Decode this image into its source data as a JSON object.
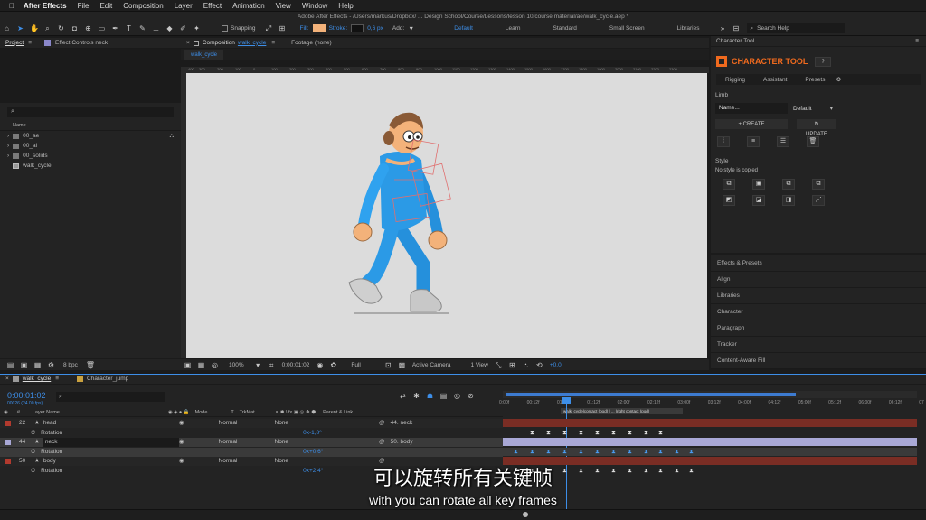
{
  "menubar": {
    "app": "After Effects",
    "items": [
      "File",
      "Edit",
      "Composition",
      "Layer",
      "Effect",
      "Animation",
      "View",
      "Window",
      "Help"
    ]
  },
  "title": "Adobe After Effects - /Users/markus/Dropbox/ ... Design School/Course/Lessons/lesson 10/course material/ae/walk_cycle.aep *",
  "toolbar": {
    "snapping": "Snapping",
    "fill": "Fill:",
    "stroke": "Stroke:",
    "stroke_px": "0,6 px",
    "add": "Add:",
    "workspaces": [
      "Default",
      "Learn",
      "Standard",
      "Small Screen",
      "Libraries"
    ],
    "search": "Search Help"
  },
  "project": {
    "tab": "Project",
    "effects_tab": "Effect Controls neck",
    "col_name": "Name",
    "items": [
      "00_ae",
      "00_ai",
      "00_solids",
      "walk_cycle"
    ],
    "bpc": "8 bpc"
  },
  "comp": {
    "tab": "Composition",
    "tab_name": "walk_cycle",
    "footage": "Footage (none)",
    "crumb": "walk_cycle",
    "zoom": "100%",
    "time": "0:00:01:02",
    "quality": "Full",
    "camera": "Active Camera",
    "view": "1 View",
    "offset": "+0,0",
    "ruler": [
      "400",
      "300",
      "200",
      "100",
      "0",
      "100",
      "200",
      "300",
      "400",
      "500",
      "600",
      "700",
      "800",
      "900",
      "1000",
      "1100",
      "1200",
      "1300",
      "1400",
      "1500",
      "1600",
      "1700",
      "1800",
      "1900",
      "2000",
      "2100",
      "2200",
      "2300"
    ]
  },
  "character": {
    "panel": "Character Tool",
    "title": "CHARACTER TOOL",
    "help": "?",
    "tabs": [
      "Rigging",
      "Assistant",
      "Presets"
    ],
    "limb": "Limb",
    "name_ph": "Name...",
    "preset": "Default",
    "create": "CREATE",
    "update": "UPDATE",
    "style": "Style",
    "style_note": "No style is copied"
  },
  "rightlist": [
    "Effects & Presets",
    "Align",
    "Libraries",
    "Character",
    "Paragraph",
    "Tracker",
    "Content-Aware Fill"
  ],
  "timeline": {
    "tab": "walk_cycle",
    "tab2": "Character_jump",
    "timecode": "0:00:01:02",
    "frames": "00026 (24.00 fps)",
    "col_layer": "Layer Name",
    "col_mode": "Mode",
    "col_t": "T",
    "col_trkmat": "TrkMat",
    "col_parent": "Parent & Link",
    "ticks": [
      "0:00f",
      "00:12f",
      "01:00f",
      "01:12f",
      "02:00f",
      "02:12f",
      "03:00f",
      "03:12f",
      "04:00f",
      "04:12f",
      "05:00f",
      "05:12f",
      "06:00f",
      "06:12f",
      "07"
    ],
    "marker": "walk_cycle|contact (pod) | ... |right contact (pod)",
    "layers": [
      {
        "num": "22",
        "name": "head",
        "mode": "Normal",
        "trk": "None",
        "parent": "44. neck",
        "prop": "Rotation",
        "val": "0x-1,8°"
      },
      {
        "num": "44",
        "name": "neck",
        "mode": "Normal",
        "trk": "None",
        "parent": "50. body",
        "prop": "Rotation",
        "val": "0x+0,6°"
      },
      {
        "num": "50",
        "name": "body",
        "mode": "Normal",
        "trk": "None",
        "parent": "",
        "prop": "Rotation",
        "val": "0x+2,4°"
      }
    ]
  },
  "subtitle": {
    "zh": "可以旋转所有关键帧",
    "en": "with you can rotate all key frames"
  },
  "colors": {
    "accent": "#3d8ee8",
    "brand": "#f06a1e",
    "hoodie": "#2b9ae6",
    "bg": "#dcdcdc",
    "red_label": "#b23a2e",
    "lilac": "#a9a8d6"
  }
}
